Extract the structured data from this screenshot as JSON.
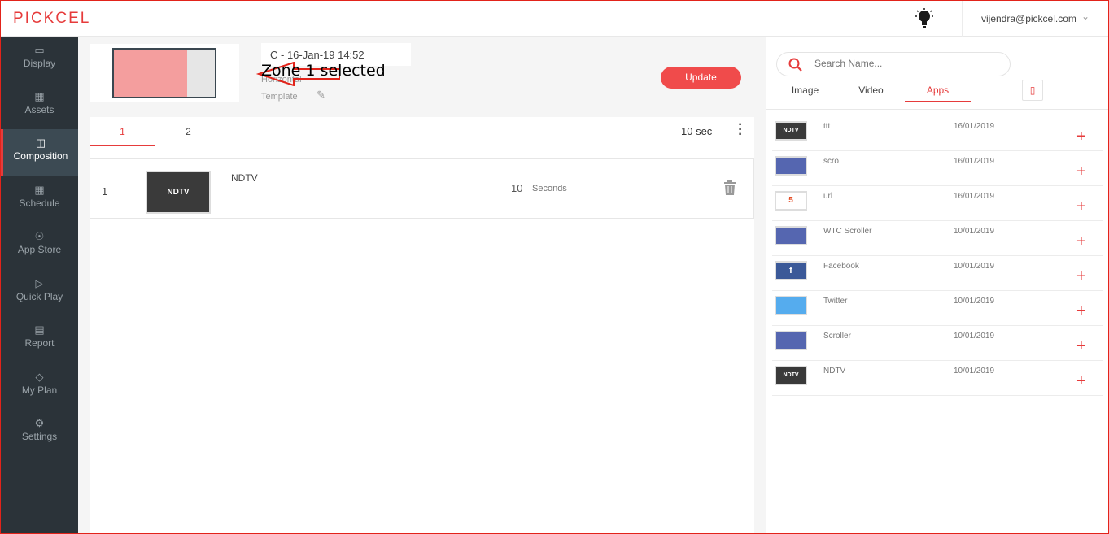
{
  "header": {
    "logo": "PICKCEL",
    "user_email": "vijendra@pickcel.com"
  },
  "sidebar": {
    "items": [
      {
        "label": "Display",
        "icon": "monitor-icon"
      },
      {
        "label": "Assets",
        "icon": "image-icon"
      },
      {
        "label": "Composition",
        "icon": "layout-icon",
        "active": true
      },
      {
        "label": "Schedule",
        "icon": "calendar-icon"
      },
      {
        "label": "App Store",
        "icon": "compass-icon"
      },
      {
        "label": "Quick Play",
        "icon": "play-icon"
      },
      {
        "label": "Report",
        "icon": "report-icon"
      },
      {
        "label": "My Plan",
        "icon": "diamond-icon"
      },
      {
        "label": "Settings",
        "icon": "gear-icon"
      }
    ]
  },
  "composition": {
    "title": "C - 16-Jan-19 14:52",
    "annotation": "Zone 1 selected",
    "orientation": "Horizontal",
    "template_label": "Template",
    "update_label": "Update",
    "zone_tabs": [
      "1",
      "2"
    ],
    "duration": "10 sec",
    "playlist": [
      {
        "index": "1",
        "name": "NDTV",
        "thumb_text": "NDTV",
        "seconds": "10",
        "seconds_label": "Seconds"
      }
    ]
  },
  "library": {
    "search_placeholder": "Search Name...",
    "tabs": [
      "Image",
      "Video",
      "Apps"
    ],
    "active_tab": "Apps",
    "apps": [
      {
        "name": "ttt",
        "date": "16/01/2019",
        "thumb_text": "NDTV",
        "thumb_color": "#3a3a3a"
      },
      {
        "name": "scro",
        "date": "16/01/2019",
        "thumb_text": "",
        "thumb_color": "#5566b0"
      },
      {
        "name": "url",
        "date": "16/01/2019",
        "thumb_text": "5",
        "thumb_color": "#ffffff"
      },
      {
        "name": "WTC Scroller",
        "date": "10/01/2019",
        "thumb_text": "",
        "thumb_color": "#5566b0"
      },
      {
        "name": "Facebook",
        "date": "10/01/2019",
        "thumb_text": "f",
        "thumb_color": "#3b5998"
      },
      {
        "name": "Twitter",
        "date": "10/01/2019",
        "thumb_text": "",
        "thumb_color": "#55acee"
      },
      {
        "name": "Scroller",
        "date": "10/01/2019",
        "thumb_text": "",
        "thumb_color": "#5566b0"
      },
      {
        "name": "NDTV",
        "date": "10/01/2019",
        "thumb_text": "NDTV",
        "thumb_color": "#3a3a3a"
      }
    ]
  },
  "colors": {
    "accent": "#e63b3b",
    "sidebar": "#2b3339",
    "sidebar_active": "#3c4a53"
  }
}
